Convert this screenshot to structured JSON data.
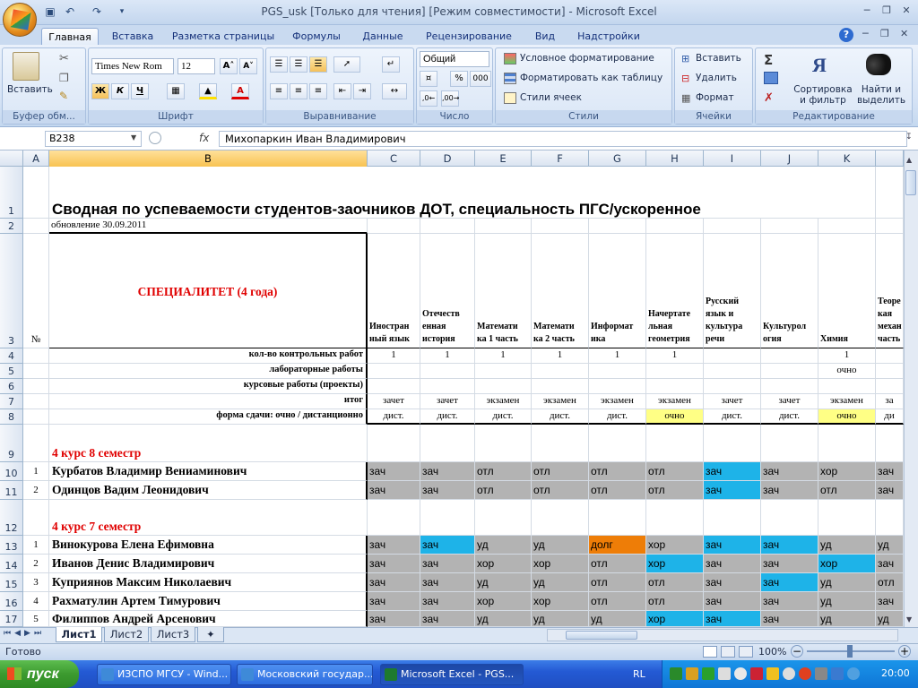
{
  "window": {
    "title": "PGS_usk  [Только для чтения]  [Режим совместимости] - Microsoft Excel"
  },
  "ribbon": {
    "tabs": [
      "Главная",
      "Вставка",
      "Разметка страницы",
      "Формулы",
      "Данные",
      "Рецензирование",
      "Вид",
      "Надстройки"
    ],
    "groups": {
      "clipboard": {
        "label": "Буфер обм...",
        "paste": "Вставить"
      },
      "font": {
        "label": "Шрифт",
        "font_name": "Times New Rom",
        "font_size": "12",
        "bold": "Ж",
        "italic": "К",
        "underline": "Ч"
      },
      "alignment": {
        "label": "Выравнивание"
      },
      "number": {
        "label": "Число",
        "format": "Общий",
        "percent": "%",
        "thousands": "000"
      },
      "styles": {
        "label": "Стили",
        "conditional": "Условное форматирование",
        "as_table": "Форматировать как таблицу",
        "cell_styles": "Стили ячеек"
      },
      "cells": {
        "label": "Ячейки",
        "insert": "Вставить",
        "delete": "Удалить",
        "format": "Формат"
      },
      "editing": {
        "label": "Редактирование",
        "sort": "Сортировка и фильтр",
        "find": "Найти и выделить"
      }
    }
  },
  "formula_bar": {
    "name_box": "B238",
    "fx": "fx",
    "value": "Михопаркин Иван Владимирович"
  },
  "columns": [
    "A",
    "B",
    "C",
    "D",
    "E",
    "F",
    "G",
    "H",
    "I",
    "J",
    "K",
    ""
  ],
  "rows": [
    "1",
    "2",
    "3",
    "4",
    "5",
    "6",
    "7",
    "8",
    "9",
    "10",
    "11",
    "12",
    "13",
    "14",
    "15",
    "16",
    "17"
  ],
  "sheet": {
    "title": "Сводная по успеваемости студентов-заочников ДОТ, специальность ПГС/ускоренное",
    "updated": "обновление 30.09.2011",
    "specialty": "СПЕЦИАЛИТЕТ (4 года)",
    "no_header": "№",
    "subjects": [
      "Иностранный язык",
      "Отечественная история",
      "Математика 1 часть",
      "Математика 2 часть",
      "Информатика",
      "Начертательная геометрия",
      "Русский язык и культура речи",
      "Культурология",
      "Химия",
      "Теоретическая механика часть"
    ],
    "subject_lines": [
      [
        "Иностран",
        "ный язык"
      ],
      [
        "Отечеств",
        "енная",
        "история"
      ],
      [
        "Математи",
        "ка 1 часть"
      ],
      [
        "Математи",
        "ка 2 часть"
      ],
      [
        "Информат",
        "ика"
      ],
      [
        "Начертате",
        "льная",
        "геометрия"
      ],
      [
        "Русский",
        "язык и",
        "культура",
        "речи"
      ],
      [
        "Культурол",
        "огия"
      ],
      [
        "Химия"
      ],
      [
        "Теоре",
        "кая",
        "механ",
        "часть"
      ]
    ],
    "param_labels": [
      "кол-во контрольных работ",
      "лабораторные работы",
      "курсовые работы (проекты)",
      "итог",
      "форма сдачи: очно / дистанционно"
    ],
    "control_works": [
      "1",
      "1",
      "1",
      "1",
      "1",
      "1",
      "",
      "",
      "1",
      ""
    ],
    "labs": [
      "",
      "",
      "",
      "",
      "",
      "",
      "",
      "",
      "очно",
      ""
    ],
    "totals": [
      "зачет",
      "зачет",
      "экзамен",
      "экзамен",
      "экзамен",
      "экзамен",
      "зачет",
      "зачет",
      "экзамен",
      "за"
    ],
    "forms": [
      "дист.",
      "дист.",
      "дист.",
      "дист.",
      "дист.",
      "очно",
      "дист.",
      "дист.",
      "очно",
      "ди"
    ],
    "section_8": "4 курс 8 семестр",
    "section_7": "4 курс 7 семестр",
    "students_8": [
      {
        "n": "1",
        "name": "Курбатов Владимир Вениаминович",
        "grades": [
          "зач",
          "зач",
          "отл",
          "отл",
          "отл",
          "отл",
          "зач",
          "зач",
          "хор",
          "зач"
        ],
        "colors": [
          "gray",
          "gray",
          "gray",
          "gray",
          "gray",
          "gray",
          "cyan",
          "gray",
          "gray",
          "gray"
        ]
      },
      {
        "n": "2",
        "name": "Одинцов Вадим Леонидович",
        "grades": [
          "зач",
          "зач",
          "отл",
          "отл",
          "отл",
          "отл",
          "зач",
          "зач",
          "отл",
          "зач"
        ],
        "colors": [
          "gray",
          "gray",
          "gray",
          "gray",
          "gray",
          "gray",
          "cyan",
          "gray",
          "gray",
          "gray"
        ]
      }
    ],
    "students_7": [
      {
        "n": "1",
        "name": "Винокурова Елена Ефимовна",
        "grades": [
          "зач",
          "зач",
          "уд",
          "уд",
          "долг",
          "хор",
          "зач",
          "зач",
          "уд",
          "уд"
        ],
        "colors": [
          "gray",
          "cyan",
          "gray",
          "gray",
          "orange",
          "gray",
          "cyan",
          "cyan",
          "gray",
          "gray"
        ]
      },
      {
        "n": "2",
        "name": "Иванов Денис Владимирович",
        "grades": [
          "зач",
          "зач",
          "хор",
          "хор",
          "отл",
          "хор",
          "зач",
          "зач",
          "хор",
          "зач"
        ],
        "colors": [
          "gray",
          "gray",
          "gray",
          "gray",
          "gray",
          "cyan",
          "gray",
          "gray",
          "cyan",
          "gray"
        ]
      },
      {
        "n": "3",
        "name": "Куприянов Максим Николаевич",
        "grades": [
          "зач",
          "зач",
          "уд",
          "уд",
          "отл",
          "отл",
          "зач",
          "зач",
          "уд",
          "отл"
        ],
        "colors": [
          "gray",
          "gray",
          "gray",
          "gray",
          "gray",
          "gray",
          "gray",
          "cyan",
          "gray",
          "gray"
        ]
      },
      {
        "n": "4",
        "name": "Рахматулин Артем Тимурович",
        "grades": [
          "зач",
          "зач",
          "хор",
          "хор",
          "отл",
          "отл",
          "зач",
          "зач",
          "уд",
          "зач"
        ],
        "colors": [
          "gray",
          "gray",
          "gray",
          "gray",
          "gray",
          "gray",
          "gray",
          "gray",
          "gray",
          "gray"
        ]
      },
      {
        "n": "5",
        "name": "Филиппов Андрей Арсенович",
        "grades": [
          "зач",
          "зач",
          "уд",
          "уд",
          "уд",
          "хор",
          "зач",
          "зач",
          "уд",
          "уд"
        ],
        "colors": [
          "gray",
          "gray",
          "gray",
          "gray",
          "gray",
          "cyan",
          "cyan",
          "gray",
          "gray",
          "gray"
        ]
      }
    ]
  },
  "sheet_tabs": [
    "Лист1",
    "Лист2",
    "Лист3"
  ],
  "status": {
    "ready": "Готово",
    "zoom": "100%"
  },
  "taskbar": {
    "start": "пуск",
    "items": [
      "ИЗСПО МГСУ - Wind...",
      "Московский государ...",
      "Microsoft Excel - PGS..."
    ],
    "lang": "RL",
    "time": "20:00"
  },
  "colors": {
    "gray": "#b3b3b3",
    "cyan": "#1eb3e8",
    "orange": "#ee7d07",
    "yellow": "#ffff85",
    "section_red": "#e00000"
  }
}
